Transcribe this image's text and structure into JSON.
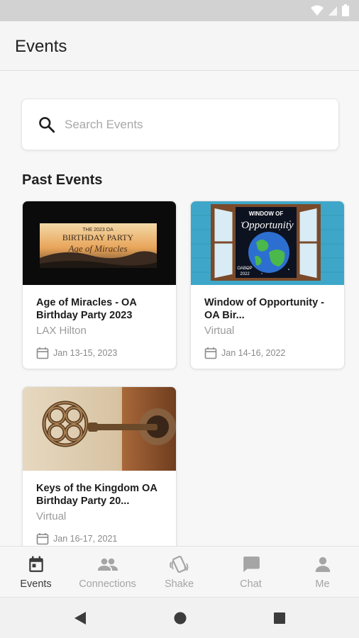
{
  "app_bar": {
    "title": "Events"
  },
  "search": {
    "placeholder": "Search Events"
  },
  "sections": {
    "past_title": "Past Events"
  },
  "events": [
    {
      "title": "Age of Miracles - OA Birthday Party 2023",
      "location": "LAX Hilton",
      "date": "Jan 13-15, 2023",
      "image": {
        "line1": "THE 2023 OA",
        "line2": "BIRTHDAY PARTY",
        "line3": "Age of Miracles"
      }
    },
    {
      "title": "Window of Opportunity - OA Bir...",
      "location": "Virtual",
      "date": "Jan 14-16, 2022",
      "image": {
        "line1": "WINDOW OF",
        "line2": "Opportunity",
        "line3": "OABOP",
        "line4": "2022"
      }
    },
    {
      "title": "Keys of the Kingdom OA Birthday Party 20...",
      "location": "Virtual",
      "date": "Jan 16-17, 2021"
    }
  ],
  "bottom_nav": [
    {
      "label": "Events",
      "icon": "calendar-icon",
      "active": true
    },
    {
      "label": "Connections",
      "icon": "people-icon",
      "active": false
    },
    {
      "label": "Shake",
      "icon": "shake-icon",
      "active": false
    },
    {
      "label": "Chat",
      "icon": "chat-icon",
      "active": false
    },
    {
      "label": "Me",
      "icon": "person-icon",
      "active": false
    }
  ],
  "colors": {
    "accent": "#3a3a3a",
    "inactive": "#a5a5a5",
    "background": "#f7f7f7"
  }
}
